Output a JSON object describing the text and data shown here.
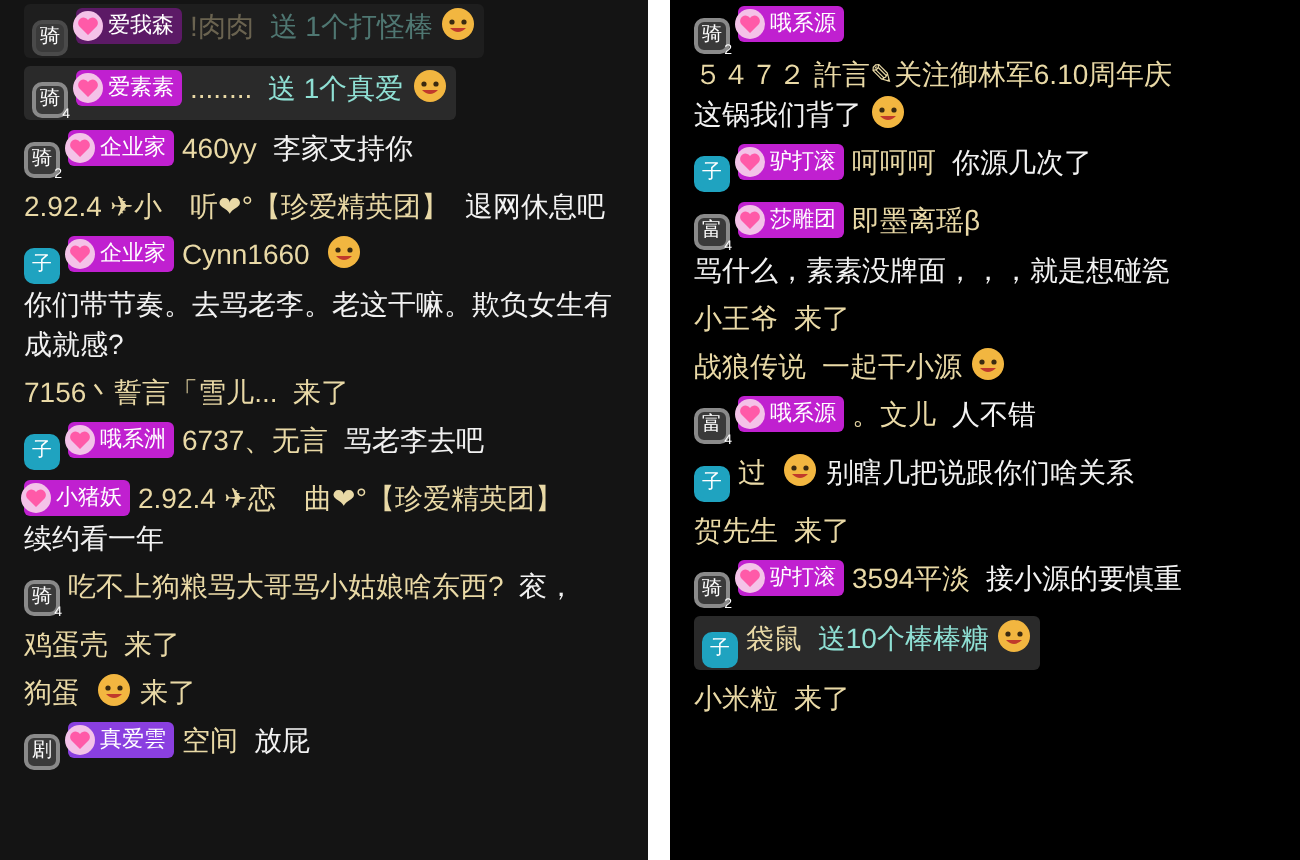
{
  "panels": [
    {
      "messages": [
        {
          "kind": "gift",
          "dimmed": true,
          "level": {
            "char": "骑",
            "color": "#4a4a4a"
          },
          "fan": {
            "label": "爱我森",
            "color": "#5c1a66"
          },
          "name": "!肉肉",
          "text": "送 1个打怪棒",
          "icon": true
        },
        {
          "kind": "gift",
          "dimmed": false,
          "level": {
            "char": "骑",
            "num": "4",
            "color": "#8a8a8a"
          },
          "fan": {
            "label": "爱素素",
            "color": "#c020d0"
          },
          "name": "........",
          "text": "送 1个真爱",
          "icon": true
        },
        {
          "kind": "chat",
          "level": {
            "char": "骑",
            "num": "2",
            "color": "#8a8a8a"
          },
          "fan": {
            "label": "企业家",
            "color": "#c020d0"
          },
          "name": "460yy",
          "text": "李家支持你"
        },
        {
          "kind": "chat",
          "name": "2.92.4 ✈小　听❤°【珍爱精英团】",
          "text": "退网休息吧"
        },
        {
          "kind": "chat",
          "level": {
            "char": "子",
            "color": "#1fa3c0"
          },
          "fan": {
            "label": "企业家",
            "color": "#c020d0"
          },
          "name": "Cynn1660",
          "name_icon": true,
          "text": "你们带节奏。去骂老李。老这干嘛。欺负女生有成就感?"
        },
        {
          "kind": "enter",
          "name": "7156丶誓言「雪儿...",
          "text": "来了"
        },
        {
          "kind": "chat",
          "level": {
            "char": "子",
            "color": "#1fa3c0"
          },
          "fan": {
            "label": "哦系洲",
            "color": "#c020d0"
          },
          "name": "6737、无言",
          "text": "骂老李去吧"
        },
        {
          "kind": "chat",
          "fan": {
            "label": "小猪妖",
            "color": "#c020d0"
          },
          "name": "2.92.4 ✈恋　曲❤°【珍爱精英团】",
          "text": "续约看一年"
        },
        {
          "kind": "chat",
          "level": {
            "char": "骑",
            "num": "4",
            "color": "#8a8a8a"
          },
          "name": "吃不上狗粮骂大哥骂小姑娘啥东西?",
          "text": "衮，"
        },
        {
          "kind": "enter",
          "name": "鸡蛋壳",
          "text": "来了"
        },
        {
          "kind": "enter",
          "name": "狗蛋",
          "name_icon": true,
          "text": "来了"
        },
        {
          "kind": "chat",
          "level": {
            "char": "剧",
            "color": "#8a8a8a"
          },
          "fan": {
            "label": "真爱雲",
            "color": "#8a3fe0"
          },
          "name": "空间",
          "text": "放屁"
        }
      ]
    },
    {
      "messages": [
        {
          "kind": "chat",
          "level": {
            "char": "骑",
            "num": "2",
            "color": "#8a8a8a"
          },
          "fan": {
            "label": "哦系源",
            "color": "#c020d0"
          },
          "name": "５４７２ 許言✎关注御林军6.10周年庆",
          "text": "这锅我们背了",
          "icon": true
        },
        {
          "kind": "chat",
          "level": {
            "char": "子",
            "color": "#1fa3c0"
          },
          "fan": {
            "label": "驴打滚",
            "color": "#c020d0"
          },
          "name": "呵呵呵",
          "text": "你源几次了"
        },
        {
          "kind": "chat",
          "level": {
            "char": "富",
            "num": "4",
            "color": "#8a8a8a"
          },
          "fan": {
            "label": "莎雕团",
            "color": "#c020d0"
          },
          "name": "即墨离瑶β",
          "text": "骂什么，素素没牌面，，，就是想碰瓷"
        },
        {
          "kind": "enter",
          "name": "小王爷",
          "text": "来了"
        },
        {
          "kind": "enter",
          "name": "战狼传说",
          "text": "一起干小源",
          "icon": true
        },
        {
          "kind": "chat",
          "level": {
            "char": "富",
            "num": "4",
            "color": "#8a8a8a"
          },
          "fan": {
            "label": "哦系源",
            "color": "#c020d0"
          },
          "name": "。文儿",
          "text": "人不错"
        },
        {
          "kind": "chat",
          "level": {
            "char": "子",
            "color": "#1fa3c0"
          },
          "name_icon": true,
          "name": "过",
          "text": "别瞎几把说跟你们啥关系"
        },
        {
          "kind": "enter",
          "name": "贺先生",
          "text": "来了"
        },
        {
          "kind": "chat",
          "level": {
            "char": "骑",
            "num": "2",
            "color": "#8a8a8a"
          },
          "fan": {
            "label": "驴打滚",
            "color": "#c020d0"
          },
          "name": "3594平淡",
          "text": "接小源的要慎重"
        },
        {
          "kind": "gift",
          "dimmed": false,
          "level": {
            "char": "子",
            "color": "#1fa3c0"
          },
          "name": "袋鼠",
          "text": "送10个棒棒糖",
          "icon": true
        },
        {
          "kind": "enter",
          "name": "小米粒",
          "text": "来了"
        }
      ]
    }
  ]
}
